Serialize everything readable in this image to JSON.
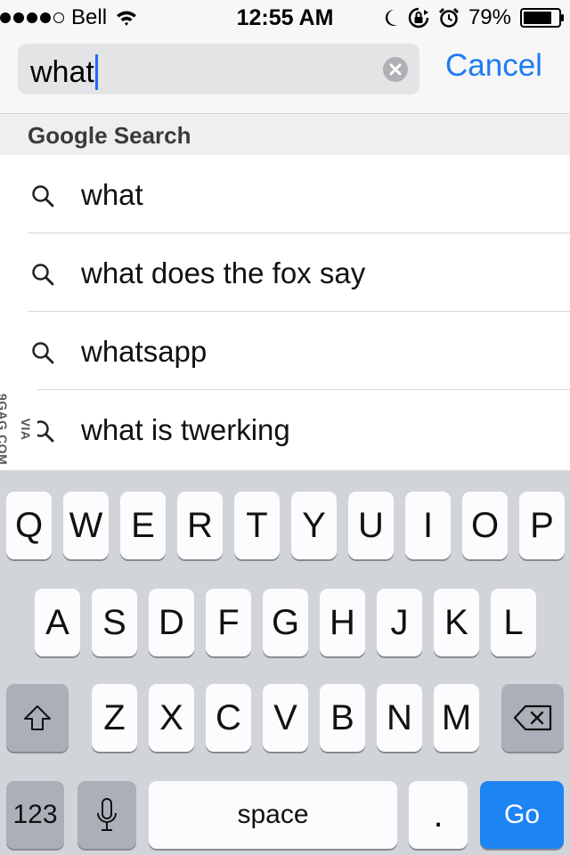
{
  "status_bar": {
    "carrier": "Bell",
    "time": "12:55 AM",
    "battery_percent": "79%",
    "signal_bars": 4,
    "signal_total": 5
  },
  "search": {
    "query": "what",
    "cancel_label": "Cancel"
  },
  "section": {
    "title": "Google Search"
  },
  "suggestions": [
    {
      "text": "what"
    },
    {
      "text": "what does the fox say"
    },
    {
      "text": "whatsapp"
    },
    {
      "text": "what is twerking"
    }
  ],
  "watermark": "VIA 9GAG.COM",
  "keyboard": {
    "row1": [
      "Q",
      "W",
      "E",
      "R",
      "T",
      "Y",
      "U",
      "I",
      "O",
      "P"
    ],
    "row2": [
      "A",
      "S",
      "D",
      "F",
      "G",
      "H",
      "J",
      "K",
      "L"
    ],
    "row3": [
      "Z",
      "X",
      "C",
      "V",
      "B",
      "N",
      "M"
    ],
    "numbers_label": "123",
    "space_label": "space",
    "period_label": ".",
    "go_label": "Go"
  },
  "colors": {
    "accent": "#1e7bf5",
    "go_key": "#1d84f3",
    "keyboard_bg": "#d1d4d9"
  }
}
